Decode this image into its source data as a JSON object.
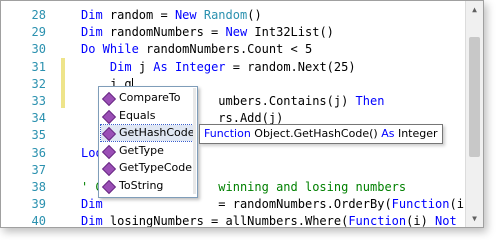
{
  "editor": {
    "lines": [
      {
        "num": "28",
        "parts": [
          {
            "t": "Dim",
            "c": "kw"
          },
          {
            "t": " random = "
          },
          {
            "t": "New",
            "c": "kw"
          },
          {
            "t": " "
          },
          {
            "t": "Random",
            "c": "ty"
          },
          {
            "t": "()"
          }
        ]
      },
      {
        "num": "29",
        "parts": [
          {
            "t": "Dim",
            "c": "kw"
          },
          {
            "t": " randomNumbers = "
          },
          {
            "t": "New",
            "c": "kw"
          },
          {
            "t": " Int32List()"
          }
        ]
      },
      {
        "num": "30",
        "parts": [
          {
            "t": "Do While",
            "c": "kw"
          },
          {
            "t": " randomNumbers.Count < 5"
          }
        ]
      },
      {
        "num": "31",
        "parts": [
          {
            "t": "    "
          },
          {
            "t": "Dim",
            "c": "kw"
          },
          {
            "t": " j "
          },
          {
            "t": "As Integer",
            "c": "kw"
          },
          {
            "t": " = random.Next(25)"
          }
        ]
      },
      {
        "num": "32",
        "parts": [
          {
            "t": "    j.g"
          }
        ]
      },
      {
        "num": "33",
        "parts": [
          {
            "t": "                   umbers.Contains(j) "
          },
          {
            "t": "Then",
            "c": "kw"
          }
        ]
      },
      {
        "num": "34",
        "parts": [
          {
            "t": "                   rs.Add(j)"
          }
        ]
      },
      {
        "num": "35",
        "parts": [
          {
            "t": ""
          }
        ]
      },
      {
        "num": "36",
        "parts": [
          {
            "t": "Loo",
            "c": "kw"
          }
        ]
      },
      {
        "num": "37",
        "parts": [
          {
            "t": ""
          }
        ]
      },
      {
        "num": "38",
        "parts": [
          {
            "t": "' G",
            "c": "cm"
          },
          {
            "t": "                winning and losing numbers",
            "c": "cm"
          }
        ]
      },
      {
        "num": "39",
        "parts": [
          {
            "t": "Dim",
            "c": "kw"
          },
          {
            "t": "                = randomNumbers.OrderBy("
          },
          {
            "t": "Function",
            "c": "kw"
          },
          {
            "t": "(i) i)."
          }
        ]
      },
      {
        "num": "40",
        "parts": [
          {
            "t": "Dim",
            "c": "kw"
          },
          {
            "t": " losingNumbers = allNumbers.Where("
          },
          {
            "t": "Function",
            "c": "kw"
          },
          {
            "t": "(i) "
          },
          {
            "t": "Not",
            "c": "kw"
          }
        ]
      }
    ]
  },
  "intellisense": {
    "items": [
      "CompareTo",
      "Equals",
      "GetHashCode",
      "GetType",
      "GetTypeCode",
      "ToString"
    ],
    "selected_index": 2,
    "icon": "method-icon"
  },
  "tooltip": {
    "kw1": "Function",
    "sig": " Object.GetHashCode() ",
    "kw2": "As",
    "ret": " Integer"
  },
  "colors": {
    "keyword": "#0000ff",
    "type": "#2b91af",
    "comment": "#008000",
    "line_number": "#2b91af",
    "change_bar": "#eee48a",
    "method_icon": "#9b4fb6"
  }
}
